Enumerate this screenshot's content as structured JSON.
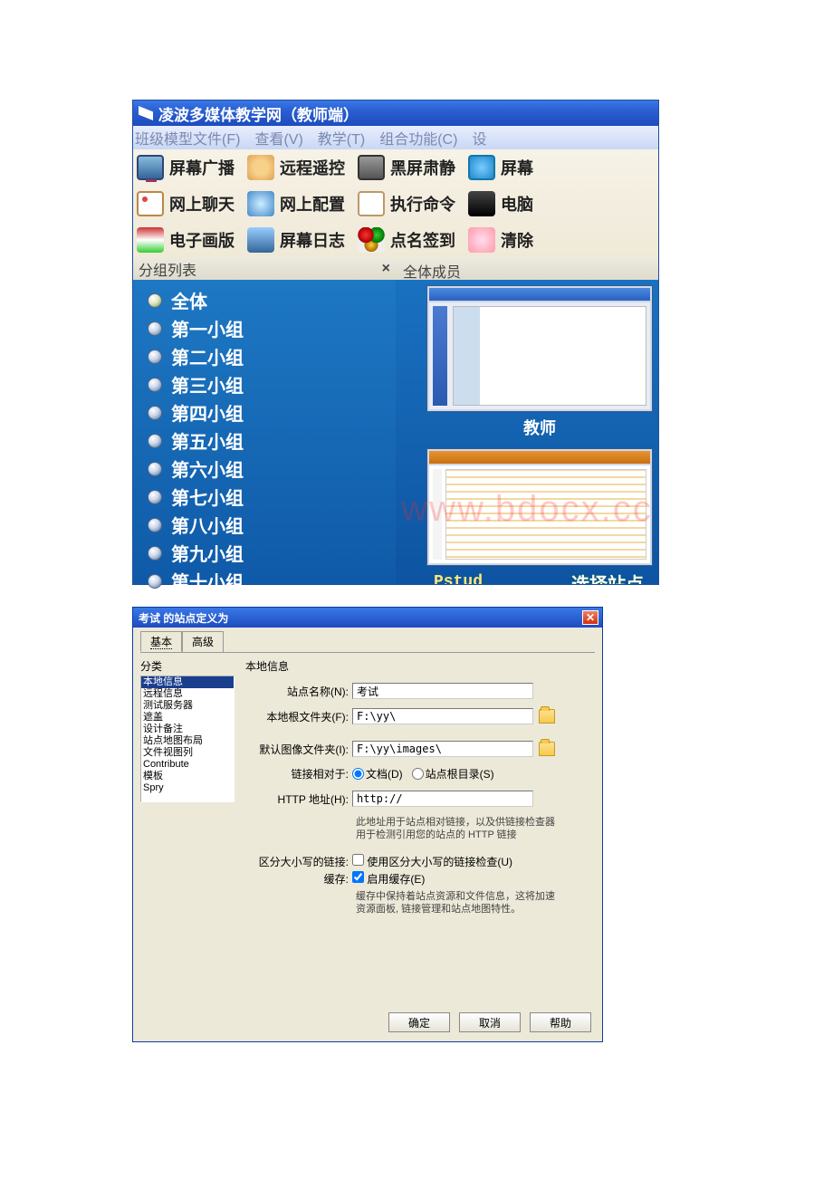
{
  "app": {
    "title": "凌波多媒体教学网（教师端）"
  },
  "menu": {
    "file": "班级模型文件(F)",
    "view": "查看(V)",
    "teach": "教学(T)",
    "combo": "组合功能(C)",
    "more": "设"
  },
  "toolbar": {
    "r1": {
      "a": "屏幕广播",
      "b": "远程遥控",
      "c": "黑屏肃静",
      "d": "屏幕"
    },
    "r2": {
      "a": "网上聊天",
      "b": "网上配置",
      "c": "执行命令",
      "d": "电脑"
    },
    "r3": {
      "a": "电子画版",
      "b": "屏幕日志",
      "c": "点名签到",
      "d": "清除"
    }
  },
  "sidebar": {
    "header": "分组列表",
    "close": "×",
    "items": [
      {
        "label": "全体"
      },
      {
        "label": "第一小组"
      },
      {
        "label": "第二小组"
      },
      {
        "label": "第三小组"
      },
      {
        "label": "第四小组"
      },
      {
        "label": "第五小组"
      },
      {
        "label": "第六小组"
      },
      {
        "label": "第七小组"
      },
      {
        "label": "第八小组"
      },
      {
        "label": "第九小组"
      },
      {
        "label": "第十小组"
      }
    ]
  },
  "content": {
    "header": "全体成员",
    "thumb1_caption": "教师",
    "pstud_label": "Pstud",
    "select_site": "选择站点"
  },
  "watermark": "www.bdocx.cc",
  "dialog": {
    "title": "考试 的站点定义为",
    "tabs": {
      "basic": "基本",
      "advanced": "高级"
    },
    "category_label": "分类",
    "categories": [
      "本地信息",
      "远程信息",
      "测试服务器",
      "遮盖",
      "设计备注",
      "站点地图布局",
      "文件视图列",
      "Contribute",
      "模板",
      "Spry"
    ],
    "section_title": "本地信息",
    "labels": {
      "site_name": "站点名称(N):",
      "local_root": "本地根文件夹(F):",
      "default_img": "默认图像文件夹(I):",
      "link_relative": "链接相对于:",
      "doc_radio": "文档(D)",
      "siteroot_radio": "站点根目录(S)",
      "http_addr": "HTTP 地址(H):",
      "http_note": "此地址用于站点相对链接，以及供链接检查器用于检测引用您的站点的 HTTP 链接",
      "case_label": "区分大小写的链接:",
      "case_check": "使用区分大小写的链接检查(U)",
      "cache_label": "缓存:",
      "cache_check": "启用缓存(E)",
      "cache_note": "缓存中保持着站点资源和文件信息，这将加速资源面板, 链接管理和站点地图特性。"
    },
    "values": {
      "site_name": "考试",
      "local_root": "F:\\yy\\",
      "default_img": "F:\\yy\\images\\",
      "http_addr": "http://"
    },
    "buttons": {
      "ok": "确定",
      "cancel": "取消",
      "help": "帮助"
    }
  }
}
